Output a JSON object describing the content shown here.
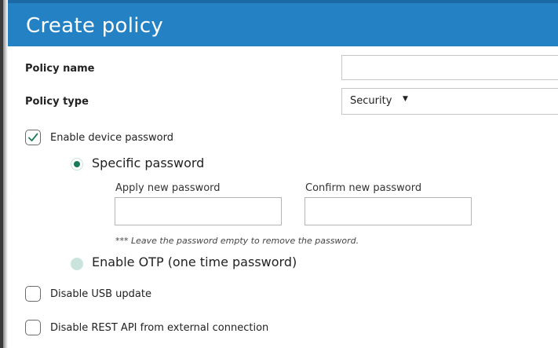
{
  "dialog": {
    "title": "Create policy"
  },
  "form": {
    "policy_name_label": "Policy name",
    "policy_name_value": "",
    "policy_type_label": "Policy type",
    "policy_type_value": "Security",
    "enable_device_password": {
      "label": "Enable device password",
      "checked": true
    },
    "password_mode": {
      "specific_label": "Specific password",
      "specific_selected": true,
      "otp_label": "Enable OTP (one time password)",
      "otp_selected": false
    },
    "apply_password_label": "Apply new password",
    "confirm_password_label": "Confirm new password",
    "password_note": "*** Leave the password empty to remove the password.",
    "disable_usb_update": {
      "label": "Disable USB update",
      "checked": false
    },
    "disable_rest_api": {
      "label": "Disable REST API from external connection",
      "checked": false
    }
  },
  "icons": {
    "checkmark": "check-icon",
    "dropdown": "caret-down-icon"
  },
  "colors": {
    "title_bar": "#2481c4",
    "accent_green": "#1b7a5c",
    "radio_off": "#c8e4dc"
  }
}
